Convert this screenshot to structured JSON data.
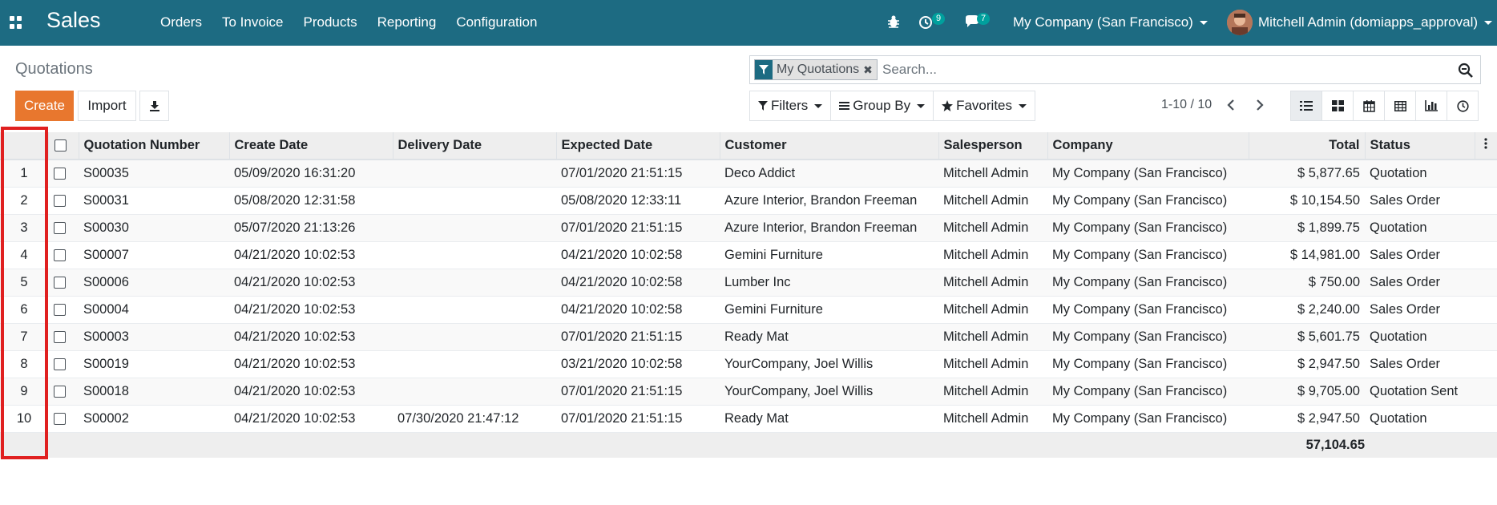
{
  "navbar": {
    "app_title": "Sales",
    "menu": [
      "Orders",
      "To Invoice",
      "Products",
      "Reporting",
      "Configuration"
    ],
    "activity_count": "9",
    "messages_count": "7",
    "company": "My Company (San Francisco)",
    "user": "Mitchell Admin (domiapps_approval)"
  },
  "control_panel": {
    "title": "Quotations",
    "create_label": "Create",
    "import_label": "Import",
    "search": {
      "facet": "My Quotations",
      "placeholder": "Search..."
    },
    "filters_label": "Filters",
    "group_by_label": "Group By",
    "favorites_label": "Favorites",
    "pager": "1-10 / 10"
  },
  "colors": {
    "navbar": "#1d6b82",
    "primary_button": "#e8772e",
    "badge": "#00a09d",
    "highlight": "#e02020"
  },
  "table": {
    "columns": [
      "Quotation Number",
      "Create Date",
      "Delivery Date",
      "Expected Date",
      "Customer",
      "Salesperson",
      "Company",
      "Total",
      "Status"
    ],
    "rows": [
      {
        "n": "1",
        "number": "S00035",
        "create": "05/09/2020 16:31:20",
        "delivery": "",
        "expected": "07/01/2020 21:51:15",
        "customer": "Deco Addict",
        "salesperson": "Mitchell Admin",
        "company": "My Company (San Francisco)",
        "total": "$ 5,877.65",
        "status": "Quotation"
      },
      {
        "n": "2",
        "number": "S00031",
        "create": "05/08/2020 12:31:58",
        "delivery": "",
        "expected": "05/08/2020 12:33:11",
        "customer": "Azure Interior, Brandon Freeman",
        "salesperson": "Mitchell Admin",
        "company": "My Company (San Francisco)",
        "total": "$ 10,154.50",
        "status": "Sales Order"
      },
      {
        "n": "3",
        "number": "S00030",
        "create": "05/07/2020 21:13:26",
        "delivery": "",
        "expected": "07/01/2020 21:51:15",
        "customer": "Azure Interior, Brandon Freeman",
        "salesperson": "Mitchell Admin",
        "company": "My Company (San Francisco)",
        "total": "$ 1,899.75",
        "status": "Quotation"
      },
      {
        "n": "4",
        "number": "S00007",
        "create": "04/21/2020 10:02:53",
        "delivery": "",
        "expected": "04/21/2020 10:02:58",
        "customer": "Gemini Furniture",
        "salesperson": "Mitchell Admin",
        "company": "My Company (San Francisco)",
        "total": "$ 14,981.00",
        "status": "Sales Order"
      },
      {
        "n": "5",
        "number": "S00006",
        "create": "04/21/2020 10:02:53",
        "delivery": "",
        "expected": "04/21/2020 10:02:58",
        "customer": "Lumber Inc",
        "salesperson": "Mitchell Admin",
        "company": "My Company (San Francisco)",
        "total": "$ 750.00",
        "status": "Sales Order"
      },
      {
        "n": "6",
        "number": "S00004",
        "create": "04/21/2020 10:02:53",
        "delivery": "",
        "expected": "04/21/2020 10:02:58",
        "customer": "Gemini Furniture",
        "salesperson": "Mitchell Admin",
        "company": "My Company (San Francisco)",
        "total": "$ 2,240.00",
        "status": "Sales Order"
      },
      {
        "n": "7",
        "number": "S00003",
        "create": "04/21/2020 10:02:53",
        "delivery": "",
        "expected": "07/01/2020 21:51:15",
        "customer": "Ready Mat",
        "salesperson": "Mitchell Admin",
        "company": "My Company (San Francisco)",
        "total": "$ 5,601.75",
        "status": "Quotation"
      },
      {
        "n": "8",
        "number": "S00019",
        "create": "04/21/2020 10:02:53",
        "delivery": "",
        "expected": "03/21/2020 10:02:58",
        "customer": "YourCompany, Joel Willis",
        "salesperson": "Mitchell Admin",
        "company": "My Company (San Francisco)",
        "total": "$ 2,947.50",
        "status": "Sales Order"
      },
      {
        "n": "9",
        "number": "S00018",
        "create": "04/21/2020 10:02:53",
        "delivery": "",
        "expected": "07/01/2020 21:51:15",
        "customer": "YourCompany, Joel Willis",
        "salesperson": "Mitchell Admin",
        "company": "My Company (San Francisco)",
        "total": "$ 9,705.00",
        "status": "Quotation Sent"
      },
      {
        "n": "10",
        "number": "S00002",
        "create": "04/21/2020 10:02:53",
        "delivery": "07/30/2020 21:47:12",
        "expected": "07/01/2020 21:51:15",
        "customer": "Ready Mat",
        "salesperson": "Mitchell Admin",
        "company": "My Company (San Francisco)",
        "total": "$ 2,947.50",
        "status": "Quotation"
      }
    ],
    "footer_total": "57,104.65"
  }
}
